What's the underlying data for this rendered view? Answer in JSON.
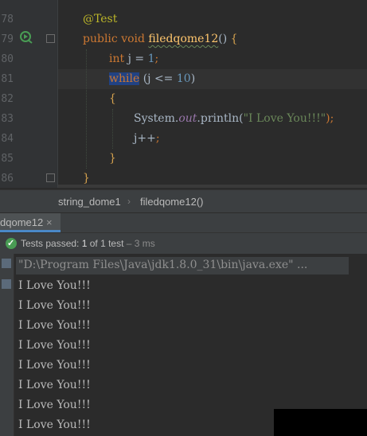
{
  "editor": {
    "lines": [
      {
        "num": "78",
        "parts": [
          {
            "t": "@Test",
            "c": "ann"
          }
        ]
      },
      {
        "num": "79",
        "parts": [
          {
            "t": "public ",
            "c": "kw"
          },
          {
            "t": "void ",
            "c": "kw"
          },
          {
            "t": "filedqome12",
            "c": "fn"
          },
          {
            "t": "() ",
            "c": ""
          },
          {
            "t": "{",
            "c": "brace"
          }
        ]
      },
      {
        "num": "80",
        "parts": [
          {
            "t": "int ",
            "c": "kw"
          },
          {
            "t": "j = ",
            "c": ""
          },
          {
            "t": "1",
            "c": "num"
          },
          {
            "t": ";",
            "c": "kw"
          }
        ]
      },
      {
        "num": "81",
        "parts": [
          {
            "t": "while",
            "c": "kw sel"
          },
          {
            "t": " (j <= ",
            "c": ""
          },
          {
            "t": "10",
            "c": "num"
          },
          {
            "t": ")",
            "c": ""
          }
        ]
      },
      {
        "num": "82",
        "parts": [
          {
            "t": "{",
            "c": "brace"
          }
        ]
      },
      {
        "num": "83",
        "parts": [
          {
            "t": "System.",
            "c": ""
          },
          {
            "t": "out",
            "c": "field"
          },
          {
            "t": ".println(",
            "c": ""
          },
          {
            "t": "\"I Love You!!!\"",
            "c": "str"
          },
          {
            "t": ");",
            "c": "kw"
          }
        ]
      },
      {
        "num": "84",
        "parts": [
          {
            "t": "j++",
            "c": ""
          },
          {
            "t": ";",
            "c": "kw"
          }
        ]
      },
      {
        "num": "85",
        "parts": [
          {
            "t": "}",
            "c": "brace"
          }
        ]
      },
      {
        "num": "86",
        "parts": [
          {
            "t": "}",
            "c": "brace"
          }
        ]
      }
    ]
  },
  "breadcrumb": {
    "class_name": "string_dome1",
    "separator": "›",
    "method_name": "filedqome12()"
  },
  "run_panel": {
    "tab_label": "dqome12",
    "close_glyph": "×"
  },
  "status": {
    "prefix": "Tests passed: ",
    "count": "1",
    "suffix": " of 1 test",
    "time": " – 3 ms"
  },
  "console": {
    "command": "\"D:\\Program Files\\Java\\jdk1.8.0_31\\bin\\java.exe\" ...",
    "output_lines": [
      "I Love You!!!",
      "I Love You!!!",
      "I Love You!!!",
      "I Love You!!!",
      "I Love You!!!",
      "I Love You!!!",
      "I Love You!!!",
      "I Love You!!!"
    ]
  },
  "colors": {
    "background": "#2b2b2b",
    "keyword": "#cc7832",
    "annotation": "#bbb529",
    "string": "#6a8759",
    "number": "#6897bb",
    "pass": "#499c54"
  },
  "icons": {
    "run_gutter": "run-test-icon",
    "pass": "check-circle-icon"
  }
}
